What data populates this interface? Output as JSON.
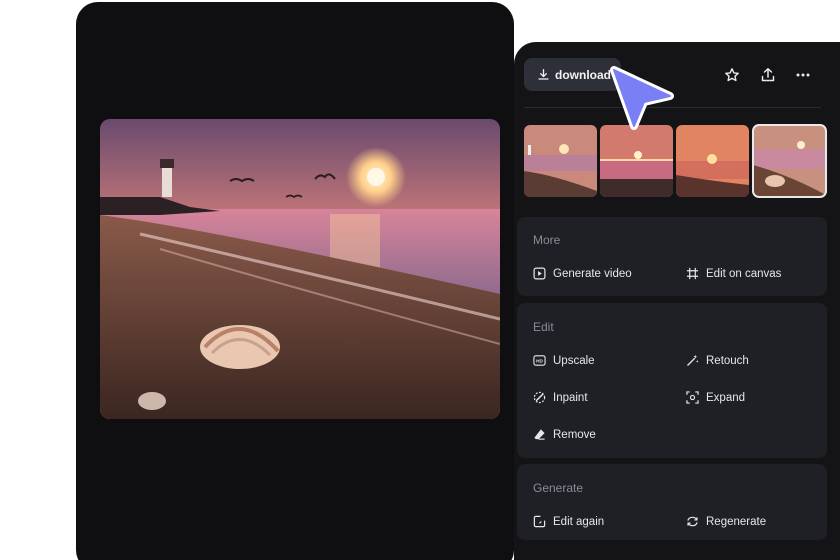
{
  "toolbar": {
    "download_label": "download",
    "download_icon": "download-icon",
    "star_icon": "star-icon",
    "share_icon": "share-icon",
    "more_icon": "more-dots-icon"
  },
  "thumbnails": {
    "count": 4,
    "selected_index": 3
  },
  "more": {
    "title": "More",
    "generate_video": "Generate video",
    "edit_on_canvas": "Edit on canvas"
  },
  "edit": {
    "title": "Edit",
    "upscale": "Upscale",
    "retouch": "Retouch",
    "inpaint": "Inpaint",
    "expand": "Expand",
    "remove": "Remove"
  },
  "generate": {
    "title": "Generate",
    "edit_again": "Edit again",
    "regenerate": "Regenerate"
  },
  "colors": {
    "panel_bg": "#0f0f12",
    "sidebar_bg": "#141417",
    "card_bg": "#1f2026",
    "button_bg": "#2d3038",
    "cursor_accent": "#7b7ff5"
  }
}
